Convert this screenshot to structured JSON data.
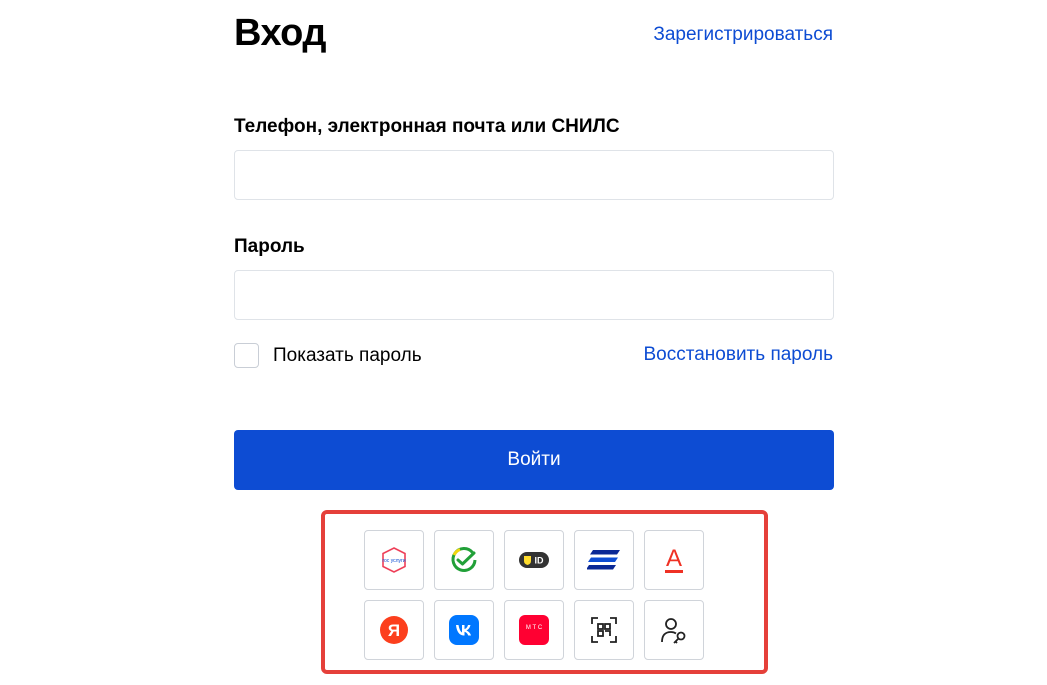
{
  "header": {
    "title": "Вход",
    "register_link": "Зарегистрироваться"
  },
  "form": {
    "login_label": "Телефон, электронная почта или СНИЛС",
    "login_value": "",
    "password_label": "Пароль",
    "password_value": "",
    "show_password_label": "Показать пароль",
    "show_password_checked": false,
    "restore_link": "Восстановить пароль",
    "submit_label": "Войти"
  },
  "providers": {
    "items": [
      {
        "icon": "gosuslugi-icon",
        "text": "гос услуги"
      },
      {
        "icon": "sber-icon"
      },
      {
        "icon": "tinkoff-id-icon",
        "text": "ID"
      },
      {
        "icon": "vtb-icon"
      },
      {
        "icon": "alfa-icon",
        "text": "А"
      },
      {
        "icon": "yandex-icon",
        "text": "Я"
      },
      {
        "icon": "vk-icon"
      },
      {
        "icon": "mts-icon",
        "text": "М Т С"
      },
      {
        "icon": "qr-icon"
      },
      {
        "icon": "user-key-icon"
      }
    ]
  },
  "colors": {
    "accent": "#0d4cd3",
    "highlight_border": "#e5403a",
    "input_border": "#dfe3e8"
  }
}
